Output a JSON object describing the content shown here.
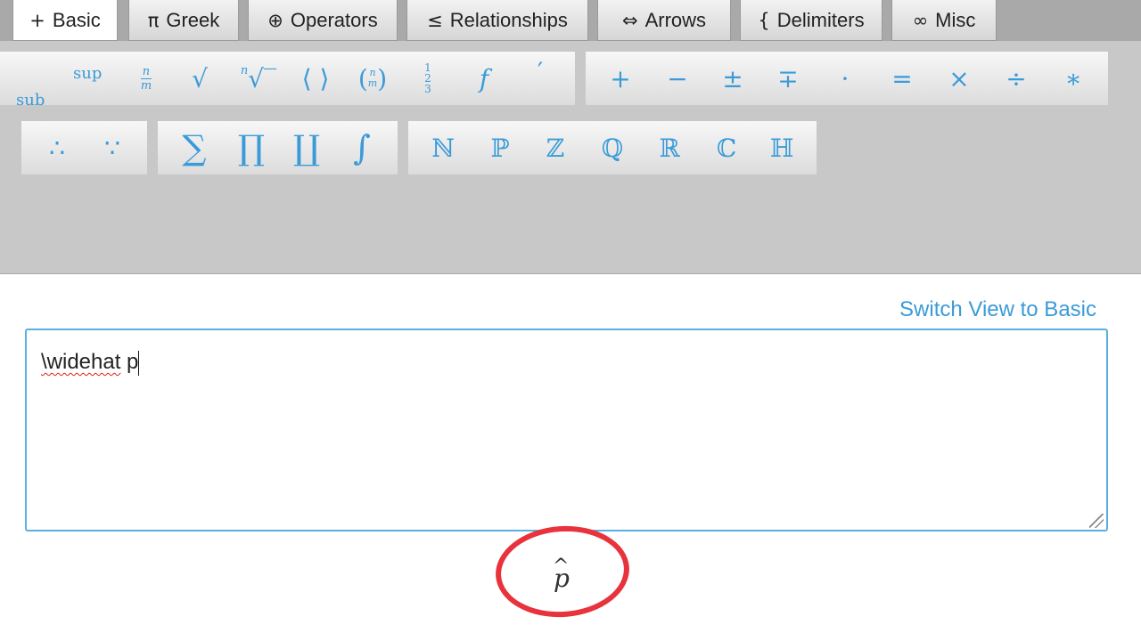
{
  "tabs": [
    {
      "glyph": "+",
      "label": "Basic",
      "active": true
    },
    {
      "glyph": "π",
      "label": "Greek",
      "active": false
    },
    {
      "glyph": "⊕",
      "label": "Operators",
      "active": false
    },
    {
      "glyph": "≤",
      "label": "Relationships",
      "active": false
    },
    {
      "glyph": "⇔",
      "label": "Arrows",
      "active": false
    },
    {
      "glyph": "{",
      "label": "Delimiters",
      "active": false
    },
    {
      "glyph": "∞",
      "label": "Misc",
      "active": false
    }
  ],
  "toolbar": {
    "basic": {
      "sup": "sup",
      "sub": "sub",
      "frac_num": "n",
      "frac_den": "m",
      "sqrt": "√",
      "nroot_index": "n",
      "nroot": "√‾",
      "angle": "⟨ ⟩",
      "binom_open": "(",
      "binom_top": "n",
      "binom_bottom": "m",
      "binom_close": ")",
      "frac3_a": "1",
      "frac3_b": "2",
      "frac3_c": "3",
      "func": "f",
      "prime": "′"
    },
    "operators": [
      "+",
      "−",
      "±",
      "∓",
      "·",
      "=",
      "×",
      "÷",
      "∗"
    ],
    "therefore": [
      "∴",
      "∵"
    ],
    "bigops": [
      "∑",
      "∏",
      "∐",
      "∫"
    ],
    "sets": [
      "ℕ",
      "ℙ",
      "ℤ",
      "ℚ",
      "ℝ",
      "ℂ",
      "ℍ"
    ]
  },
  "switch_view_label": "Switch View to Basic",
  "editor": {
    "command": "\\widehat",
    "rest": " p"
  },
  "preview": {
    "variable": "p",
    "hat": "^"
  },
  "colors": {
    "accent": "#3a9bd8",
    "annotation": "#e8323c"
  }
}
